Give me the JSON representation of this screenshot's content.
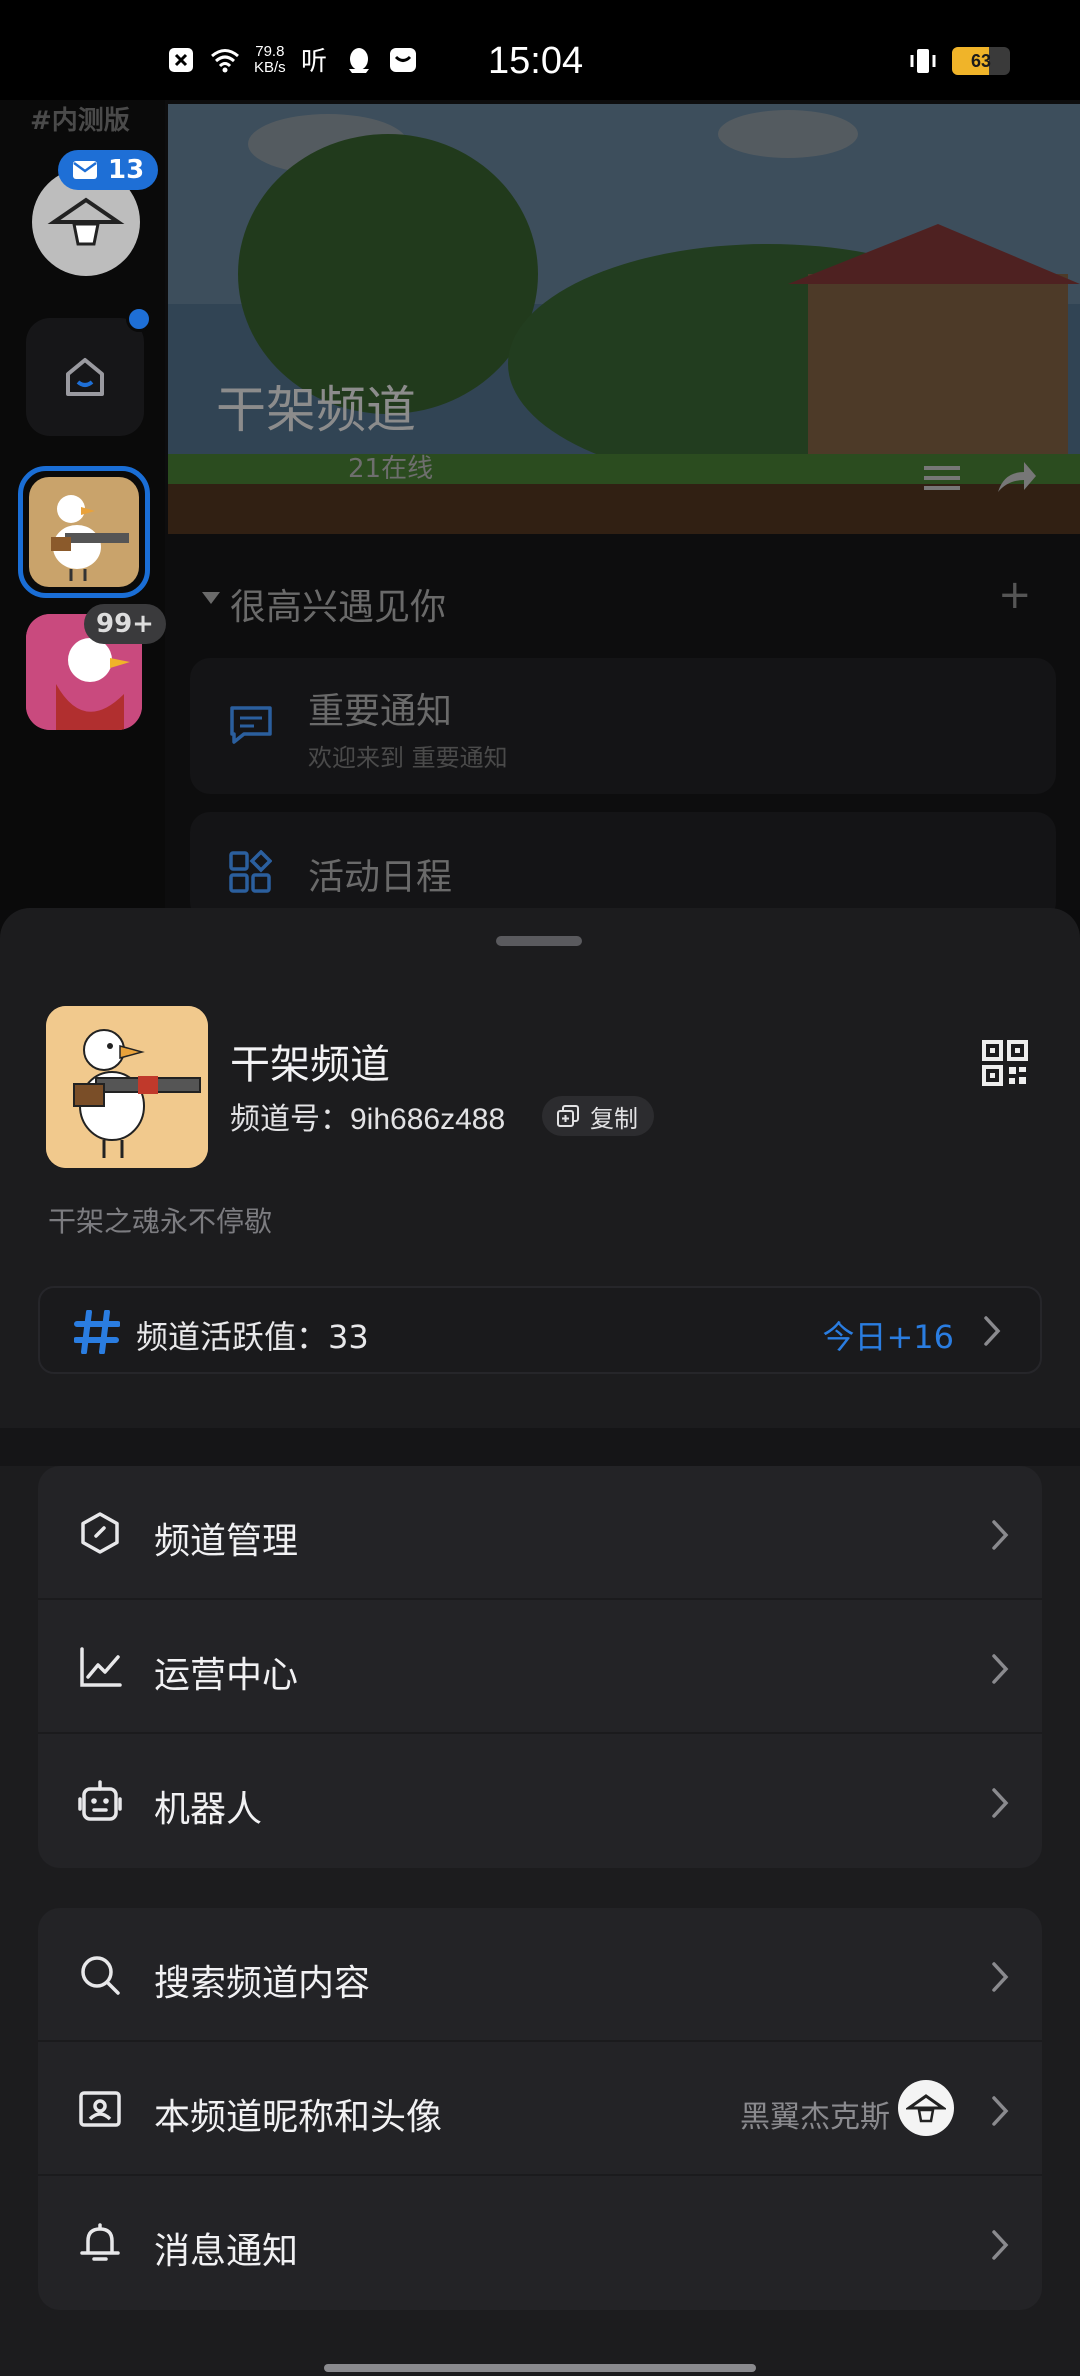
{
  "status_bar": {
    "time": "15:04",
    "net_speed_value": "79.8",
    "net_speed_unit": "KB/s",
    "battery": "63",
    "battery_level": 0.63
  },
  "background": {
    "beta_tag": "#内测版",
    "mail_badge": "13",
    "unread_badge": "99+",
    "banner_title": "干架频道",
    "online_count": "21在线",
    "section_title": "很高兴遇见你",
    "channels": [
      {
        "name": "重要通知",
        "sub": "欢迎来到 重要通知"
      },
      {
        "name": "活动日程"
      }
    ]
  },
  "sheet": {
    "guild_name": "干架频道",
    "guild_id_label": "频道号：",
    "guild_id": "9ih686z488",
    "copy_label": "复制",
    "description": "干架之魂永不停歇",
    "activity_label": "频道活跃值：",
    "activity_value": "33",
    "activity_today": "今日+16",
    "menu_group_1": [
      {
        "label": "频道管理",
        "icon": "shield-hexagon-icon"
      },
      {
        "label": "运营中心",
        "icon": "trend-chart-icon"
      },
      {
        "label": "机器人",
        "icon": "robot-icon"
      }
    ],
    "menu_group_2": [
      {
        "label": "搜索频道内容",
        "icon": "search-icon"
      },
      {
        "label": "本频道昵称和头像",
        "icon": "id-card-icon",
        "value": "黑翼杰克斯"
      },
      {
        "label": "消息通知",
        "icon": "bell-icon"
      }
    ]
  },
  "colors": {
    "accent": "#2a7de1",
    "sheet_bg": "#1c1c1e",
    "card_bg": "#232326"
  }
}
